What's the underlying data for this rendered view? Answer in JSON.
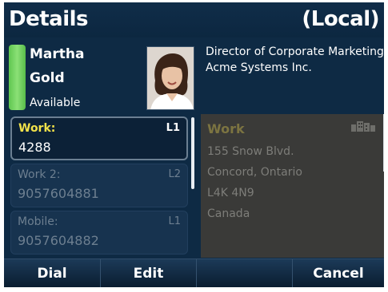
{
  "header": {
    "title": "Details",
    "mode": "(Local)"
  },
  "contact": {
    "first_name": "Martha",
    "last_name": "Gold",
    "presence": "Available",
    "presence_color": "#6ed25c",
    "job_title": "Director of Corporate Marketing",
    "company": "Acme Systems Inc."
  },
  "numbers": [
    {
      "label": "Work:",
      "line": "L1",
      "value": "4288",
      "selected": true
    },
    {
      "label": "Work 2:",
      "line": "L2",
      "value": "9057604881",
      "selected": false
    },
    {
      "label": "Mobile:",
      "line": "L1",
      "value": "9057604882",
      "selected": false
    }
  ],
  "address": {
    "label": "Work",
    "lines": [
      "155 Snow Blvd.",
      "Concord, Ontario",
      "L4K 4N9",
      "Canada"
    ],
    "icon": "building-icon"
  },
  "softkeys": [
    {
      "label": "Dial"
    },
    {
      "label": "Edit"
    },
    {
      "label": ""
    },
    {
      "label": "Cancel"
    }
  ],
  "colors": {
    "background": "#0e2a44",
    "selected_label": "#f1e14a",
    "address_panel": "#3a3a38"
  }
}
